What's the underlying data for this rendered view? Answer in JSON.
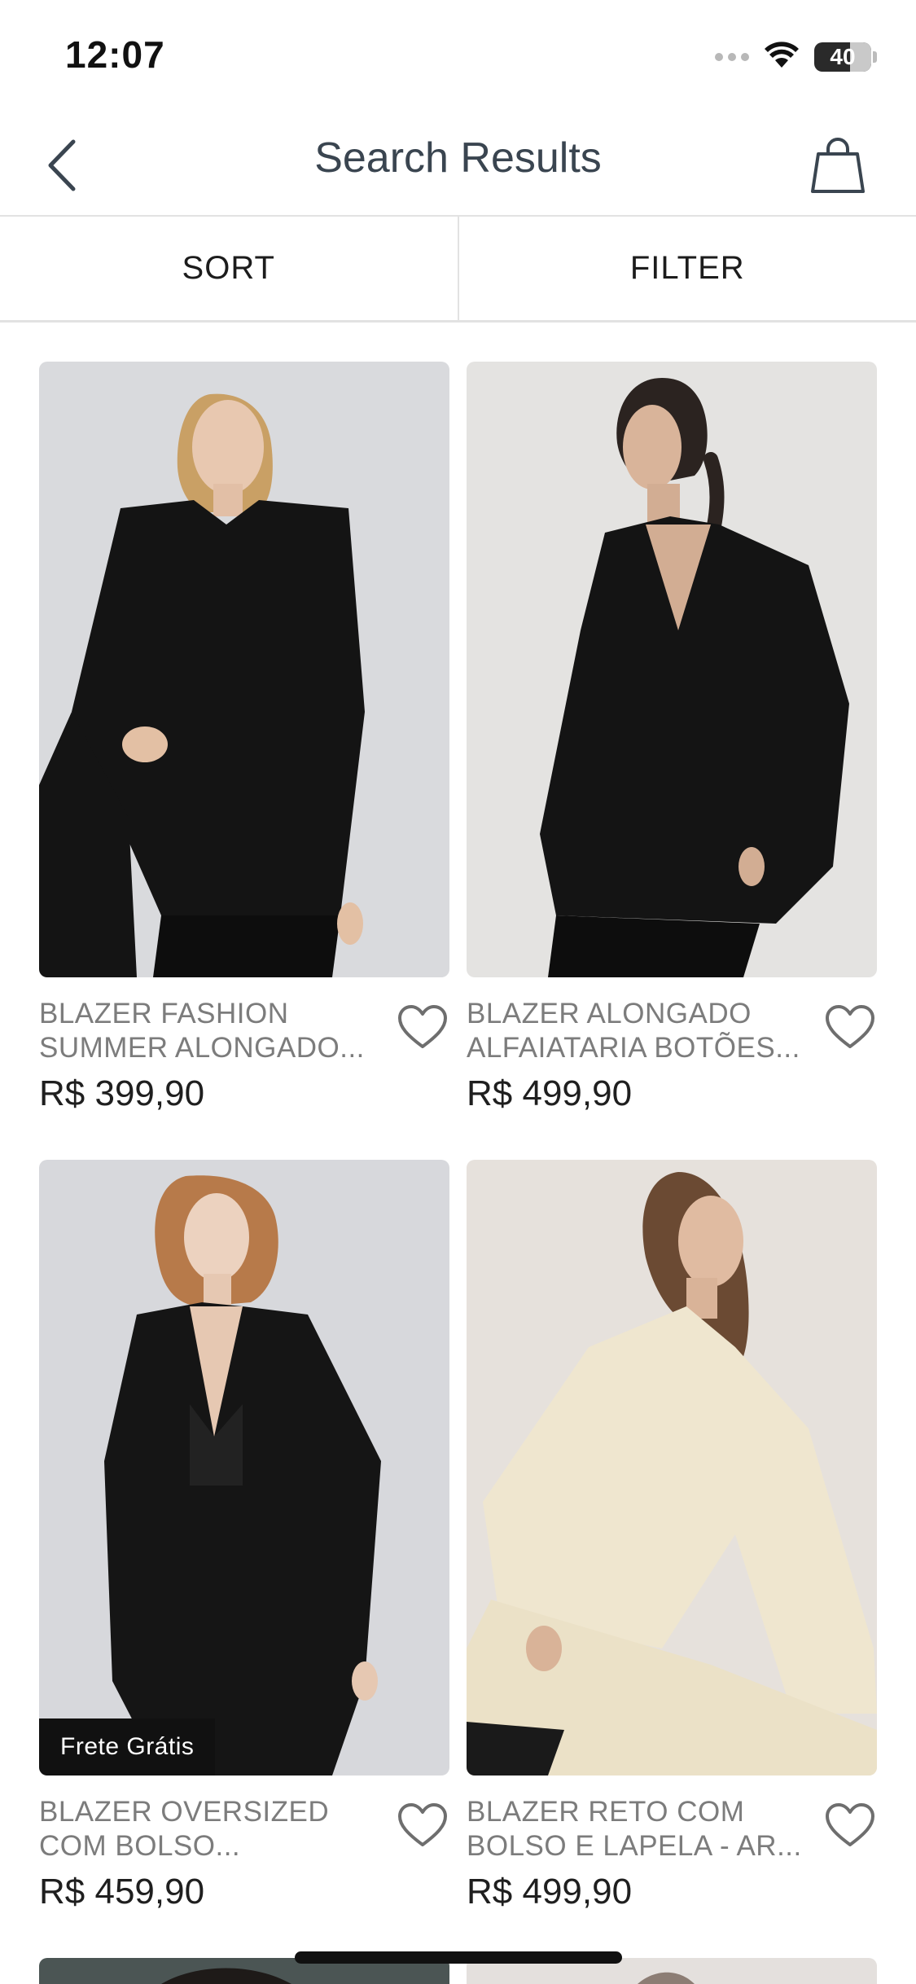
{
  "status_bar": {
    "time": "12:07",
    "battery": "40"
  },
  "nav": {
    "title": "Search Results"
  },
  "toolbar": {
    "sort_label": "SORT",
    "filter_label": "FILTER"
  },
  "products": [
    {
      "name_line1": "BLAZER FASHION",
      "name_line2": "SUMMER ALONGADO...",
      "price": "R$ 399,90",
      "badge": ""
    },
    {
      "name_line1": "BLAZER ALONGADO",
      "name_line2": "ALFAIATARIA BOTÕES...",
      "price": "R$ 499,90",
      "badge": ""
    },
    {
      "name_line1": "BLAZER OVERSIZED",
      "name_line2": "COM BOLSO...",
      "price": "R$ 459,90",
      "badge": "Frete Grátis"
    },
    {
      "name_line1": "BLAZER RETO COM",
      "name_line2": "BOLSO E LAPELA - AR...",
      "price": "R$ 499,90",
      "badge": ""
    }
  ],
  "icons": {
    "back": "chevron-left-icon",
    "bag": "shopping-bag-icon",
    "wishlist": "heart-outline-icon",
    "wifi": "wifi-icon",
    "battery": "battery-icon"
  },
  "colors": {
    "title_text": "#3a4550",
    "product_name": "#7c7c7c",
    "badge_bg": "#111111",
    "divider": "#e2e2e2"
  }
}
